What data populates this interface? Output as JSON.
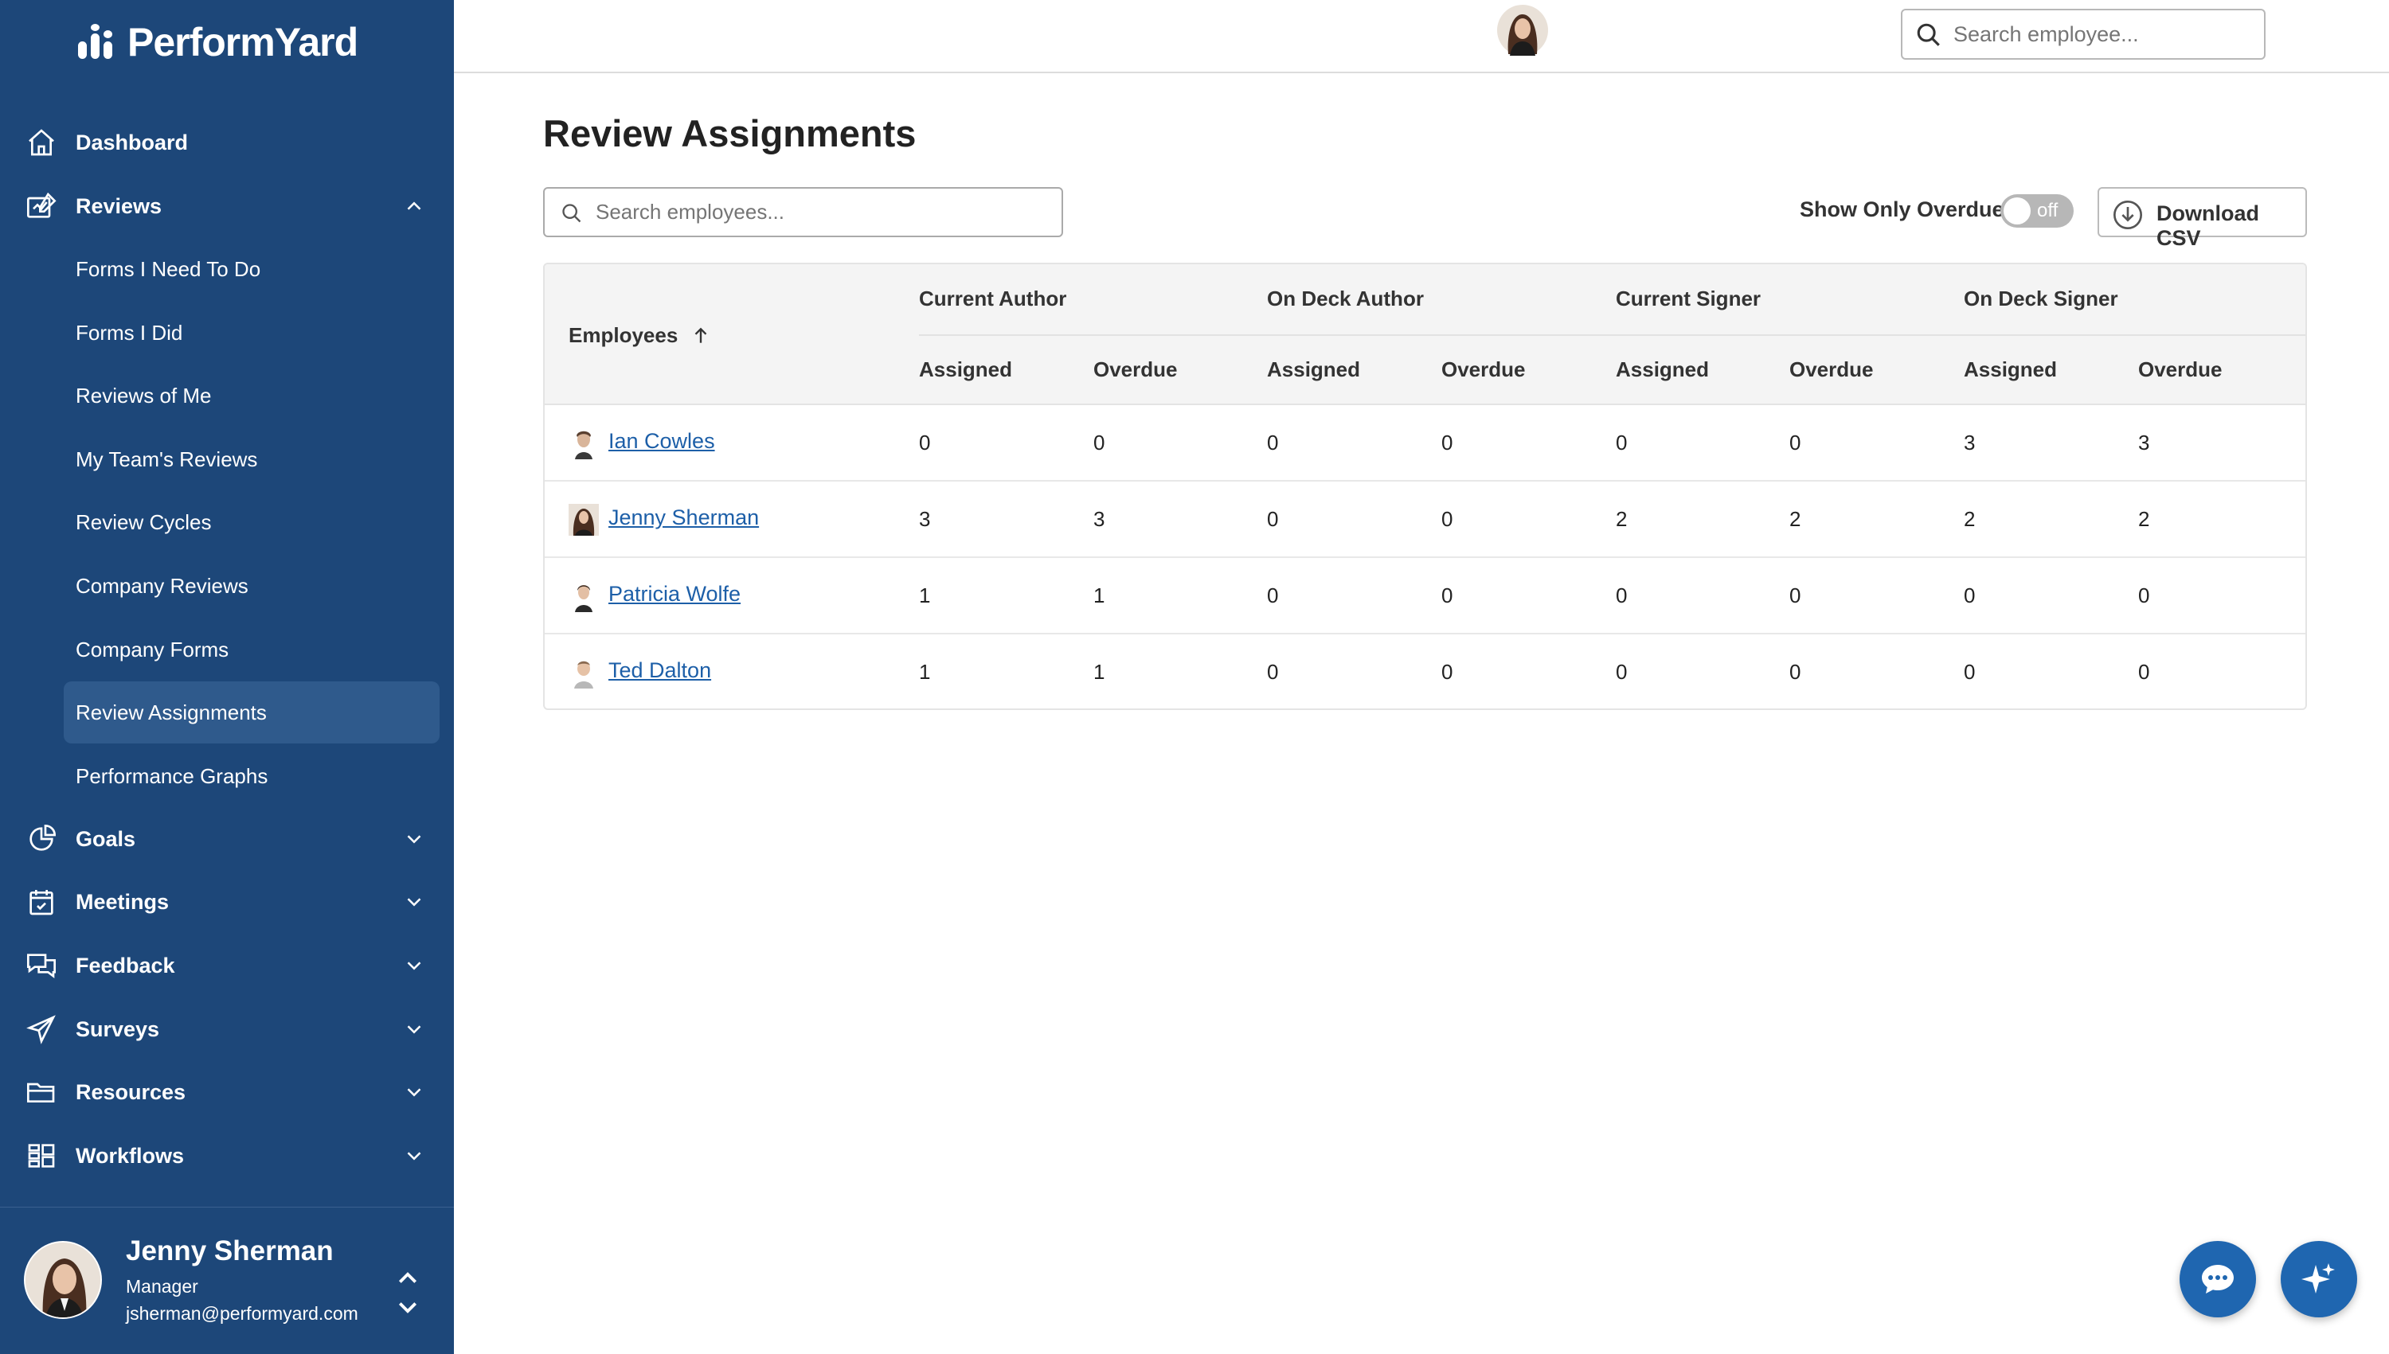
{
  "app": {
    "logo_text": "PerformYard"
  },
  "sidebar": {
    "nav": [
      {
        "label": "Dashboard",
        "icon": "home-icon"
      },
      {
        "label": "Reviews",
        "icon": "reviews-icon"
      },
      {
        "label": "Goals",
        "icon": "goals-icon"
      },
      {
        "label": "Meetings",
        "icon": "calendar-icon"
      },
      {
        "label": "Feedback",
        "icon": "feedback-icon"
      },
      {
        "label": "Surveys",
        "icon": "send-icon"
      },
      {
        "label": "Resources",
        "icon": "folder-icon"
      },
      {
        "label": "Workflows",
        "icon": "workflows-icon"
      }
    ],
    "reviews_sub": [
      "Forms I Need To Do",
      "Forms I Did",
      "Reviews of Me",
      "My Team's Reviews",
      "Review Cycles",
      "Company Reviews",
      "Company Forms",
      "Review Assignments",
      "Performance Graphs"
    ],
    "active_sub": "Review Assignments"
  },
  "user": {
    "name": "Jenny Sherman",
    "role": "Manager",
    "email": "jsherman@performyard.com"
  },
  "topbar": {
    "search_placeholder": "Search employee..."
  },
  "main": {
    "title": "Review Assignments",
    "search_placeholder": "Search employees...",
    "overdue_label": "Show Only Overdue",
    "toggle_state": "off",
    "download_label": "Download CSV"
  },
  "table": {
    "employees_header": "Employees",
    "groups": [
      "Current Author",
      "On Deck Author",
      "Current Signer",
      "On Deck Signer"
    ],
    "sub_headers": [
      "Assigned",
      "Overdue"
    ],
    "rows": [
      {
        "name": "Ian Cowles",
        "values": [
          "0",
          "0",
          "0",
          "0",
          "0",
          "0",
          "3",
          "3"
        ]
      },
      {
        "name": "Jenny Sherman",
        "values": [
          "3",
          "3",
          "0",
          "0",
          "2",
          "2",
          "2",
          "2"
        ]
      },
      {
        "name": "Patricia Wolfe",
        "values": [
          "1",
          "1",
          "0",
          "0",
          "0",
          "0",
          "0",
          "0"
        ]
      },
      {
        "name": "Ted Dalton",
        "values": [
          "1",
          "1",
          "0",
          "0",
          "0",
          "0",
          "0",
          "0"
        ]
      }
    ]
  },
  "colors": {
    "sidebar_bg": "#1d4779",
    "active_item_bg": "#2f5a8c",
    "link": "#1d5fa8",
    "fab": "#1f66b0"
  }
}
